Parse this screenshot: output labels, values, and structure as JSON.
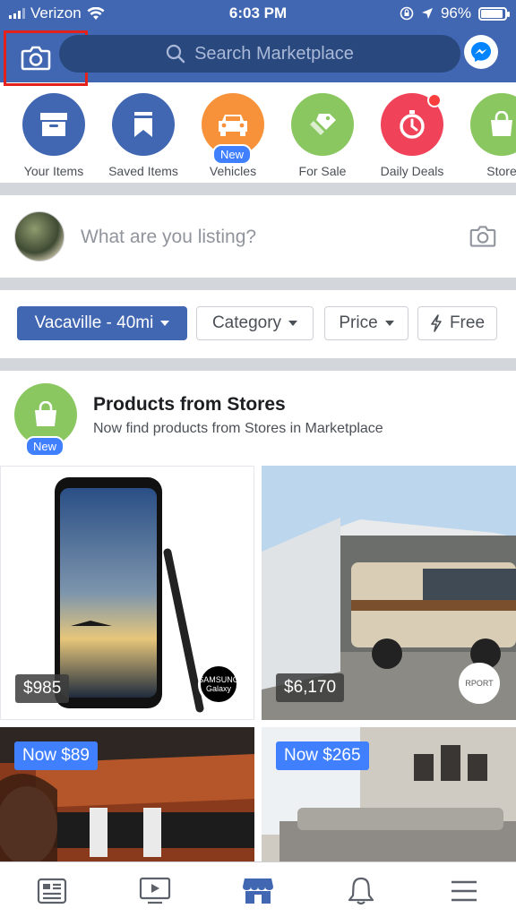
{
  "status_bar": {
    "carrier": "Verizon",
    "time": "6:03 PM",
    "battery": "96%"
  },
  "header": {
    "search_placeholder": "Search Marketplace"
  },
  "categories": [
    {
      "label": "Your Items",
      "color": "#4267b2",
      "icon": "box-icon"
    },
    {
      "label": "Saved Items",
      "color": "#4267b2",
      "icon": "bookmark-icon"
    },
    {
      "label": "Vehicles",
      "color": "#f7923b",
      "icon": "car-icon",
      "badge": "New"
    },
    {
      "label": "For Sale",
      "color": "#8ac760",
      "icon": "tag-icon"
    },
    {
      "label": "Daily Deals",
      "color": "#f0435a",
      "icon": "stopwatch-icon"
    },
    {
      "label": "Store",
      "color": "#8ac760",
      "icon": "shopping-bag-icon"
    }
  ],
  "composer": {
    "prompt": "What are you listing?"
  },
  "filters": {
    "location": "Vacaville - 40mi",
    "category": "Category",
    "price": "Price",
    "free": "Free"
  },
  "stores_section": {
    "badge": "New",
    "title": "Products from Stores",
    "subtitle": "Now find products from Stores in Marketplace"
  },
  "listings": [
    {
      "price": "$985",
      "store_badge": "SAMSUNG Galaxy"
    },
    {
      "price": "$6,170",
      "store_badge": "RPORT"
    },
    {
      "price": "Now $89"
    },
    {
      "price": "Now $265"
    }
  ],
  "colors": {
    "brand_blue": "#4267b2",
    "search_bg": "#29487d",
    "accent_blue": "#4080ff",
    "highlight_red": "#e4221b"
  }
}
